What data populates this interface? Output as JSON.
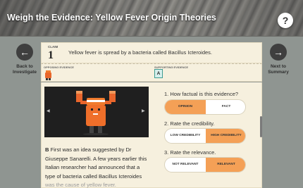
{
  "header": {
    "title": "Weigh the Evidence: Yellow Fever Origin Theories",
    "help_label": "?"
  },
  "nav": {
    "back_icon": "arrow-left-icon",
    "back_label_line1": "Back to",
    "back_label_line2": "Investigate",
    "next_icon": "arrow-right-icon",
    "next_label_line1": "Next to",
    "next_label_line2": "Summary"
  },
  "claim": {
    "tag": "CLAIM",
    "number": "1",
    "text": "Yellow fever is spread by a bacteria called Bacillus Icteroides."
  },
  "evidence_row": {
    "opposing_label": "OPPOSING EVIDENCE",
    "supporting_label": "SUPPORTING EVIDENCE",
    "supporting_card": "A"
  },
  "card": {
    "video_prev": "◀",
    "video_next": "▶",
    "evidence_letter": "B",
    "evidence_text": "First was an idea suggested by Dr Giuseppe Sanarelli. A few years earlier this Italian researcher had announced that a type of bacteria called Bacillus Icteroides",
    "evidence_text_faded": "was the cause of yellow fever."
  },
  "questions": [
    {
      "label": "1. How factual is this evidence?",
      "left": "OPINION",
      "right": "FACT",
      "selected": "left"
    },
    {
      "label": "2. Rate the credibility.",
      "left": "LOW CREDIBILITY",
      "right": "HIGH CREDIBILITY",
      "selected": "right"
    },
    {
      "label": "3. Rate the relevance.",
      "left": "NOT RELEVANT",
      "right": "RELEVANT",
      "selected": "right"
    }
  ],
  "colors": {
    "accent": "#f4a056",
    "teal": "#3e9c92",
    "panel": "#f6f0de"
  }
}
